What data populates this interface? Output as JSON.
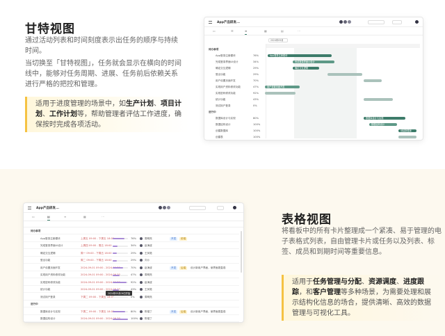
{
  "gantt_section": {
    "title": "甘特视图",
    "para1": "通过活动列表和时间刻度表示出任务的顺序与持续时间。",
    "para2": "当切换至「甘特视图」，任务就会显示在横向的时间线中，能够对任务周期、进展、任务前后依赖关系进行严格的把控和管理。",
    "highlight_prefix": "适用于进度管理的场景中，如",
    "highlight_b1": "生产计划",
    "highlight_sep1": "、",
    "highlight_b2": "项目计划",
    "highlight_sep2": "、",
    "highlight_b3": "工作计划",
    "highlight_suffix": "等，帮助管理者评估工作进度，确保按时完成各项活动。"
  },
  "table_section": {
    "title": "表格视图",
    "para1": "将看板中的所有卡片整理成一个紧凑、易于管理的电子表格式列表，自由管理卡片或任务以及列表、标签、成员和到期时间等重要信息。",
    "highlight_prefix": "适用于",
    "highlight_b1": "任务管理与分配",
    "highlight_sep1": "、",
    "highlight_b2": "资源调度",
    "highlight_sep2": "、",
    "highlight_b3": "进度跟踪",
    "highlight_mid": "，和",
    "highlight_b4": "客户管理",
    "highlight_suffix": "等多种场景，为需要处理和展示结构化信息的场合，提供清晰、高效的数据管理与可视化工具。"
  },
  "gantt_window": {
    "title": "App产品研发...",
    "date_label": "2024年09月",
    "rows": [
      {
        "name": "待办事项",
        "pct": ""
      },
      {
        "name": "App登录注册模块",
        "pct": "76%"
      },
      {
        "name": "完成登录界面UI设计",
        "pct": "34%"
      },
      {
        "name": "确定交互逻辑",
        "pct": "29%"
      },
      {
        "name": "登出功能",
        "pct": "29%"
      },
      {
        "name": "用户设置页面开发",
        "pct": "70%"
      },
      {
        "name": "实现用户资料修改功能",
        "pct": "47%"
      },
      {
        "name": "实现密码修改功能",
        "pct": "92%"
      },
      {
        "name": "统计功能",
        "pct": "43%"
      },
      {
        "name": "测试用户登录",
        "pct": "0%"
      },
      {
        "name": "进行中",
        "pct": ""
      },
      {
        "name": "数据库设计与实现",
        "pct": "80%"
      },
      {
        "name": "数据结构设计",
        "pct": "100%"
      },
      {
        "name": "创建数据库",
        "pct": "100%"
      },
      {
        "name": "创建表",
        "pct": "100%"
      }
    ],
    "bars": [
      {
        "label": "App登录注册模块"
      },
      {
        "label": "完成登录界面UI设计"
      },
      {
        "label": "确定交互逻辑"
      },
      {
        "label": "用户设置页面开发"
      },
      {
        "label": "数据库设计与实现"
      },
      {
        "label": "数据结构设计"
      },
      {
        "label": "创建数据库"
      }
    ]
  },
  "table_window": {
    "title": "App产品研发...",
    "group1": "待办事项",
    "group2": "进行中",
    "tooltip": "2024年09月06日开始",
    "rows": [
      {
        "name": "App登录注册模块",
        "date": "上周五 09:00 - 下周五 18:00",
        "pct": "76%",
        "member": "周明亮",
        "tag1": "开发",
        "tag2": "前端",
        "note": ""
      },
      {
        "name": "完成登录界面UI设计",
        "date": "上周四 09:00 - 周五 18:00",
        "pct": "34%",
        "member": "赵海波",
        "tag1": "",
        "tag2": "",
        "note": ""
      },
      {
        "name": "确定交互逻辑",
        "date": "周一 09:00 - 下周五 18:00",
        "pct": "29%",
        "member": "王凤艳",
        "tag1": "",
        "tag2": "",
        "note": ""
      },
      {
        "name": "登出功能",
        "date": "周二 09:00 - 下周五 18:00",
        "pct": "29%",
        "member": "刘小",
        "tag1": "",
        "tag2": "",
        "note": ""
      },
      {
        "name": "用户设置页面开发",
        "date": "2024-09-01 09:00 - 2024-09-30",
        "pct": "70%",
        "member": "赵海波",
        "tag1": "开发",
        "tag2": "后端",
        "note": "设计新用户界面，使界面更直观"
      },
      {
        "name": "实现用户资料修改功能",
        "date": "2024-09-01 09:00 - 2024-09-30",
        "pct": "47%",
        "member": "周明亮",
        "tag1": "",
        "tag2": "",
        "note": ""
      },
      {
        "name": "实现密码修改功能",
        "date": "2024-09-01 09:00 - 2024-09-30",
        "pct": "92%",
        "member": "赵海波",
        "tag1": "",
        "tag2": "",
        "note": ""
      },
      {
        "name": "统计功能",
        "date": "2024-09-01 09:00 - 2024-09-30",
        "pct": "43%",
        "member": "王凤艳",
        "tag1": "",
        "tag2": "",
        "note": ""
      },
      {
        "name": "测试用户登录",
        "date": "下周二 09:00 - 下周五 18:00",
        "pct": "0%",
        "member": "周明亮",
        "tag1": "",
        "tag2": "",
        "note": ""
      },
      {
        "name": "数据库设计与实现",
        "date": "下周二 09:00 - 下周五 18:00",
        "pct": "80%",
        "member": "陈端丁",
        "tag1": "开发",
        "tag2": "后端",
        "note": "设计新用户界面，使界面更直观"
      },
      {
        "name": "数据结构设计",
        "date": "2024-09-01 09:00 - 2024-09-30",
        "pct": "100%",
        "member": "陈端丁",
        "tag1": "",
        "tag2": "",
        "note": ""
      }
    ]
  },
  "colors": {
    "accent_yellow": "#f5c242",
    "bar_green": "#3d7c6a",
    "bar_teal": "#5e9987",
    "bar_gray": "#aac2bb"
  }
}
